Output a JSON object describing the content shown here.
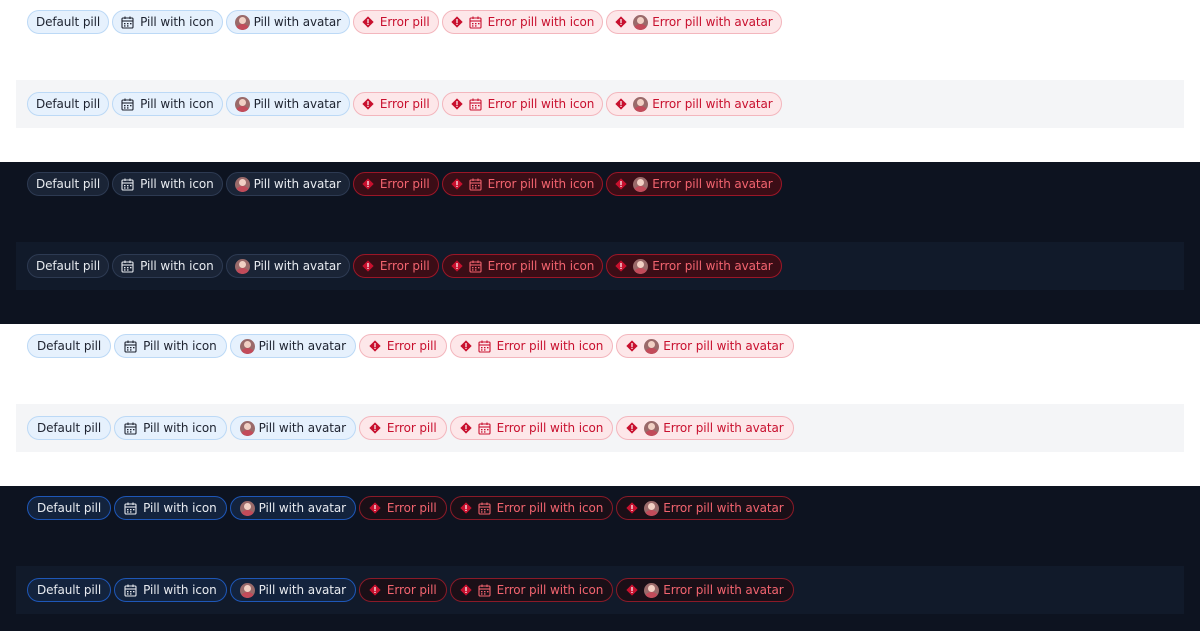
{
  "pills": {
    "default": "Default pill",
    "with_icon": "Pill with icon",
    "with_avatar": "Pill with avatar",
    "error": "Error pill",
    "error_with_icon": "Error pill with icon",
    "error_with_avatar": "Error pill with avatar"
  },
  "icons": {
    "calendar": "calendar-icon",
    "error": "error-diamond-icon",
    "avatar": "avatar"
  },
  "themes": [
    {
      "name": "light",
      "background": "#ffffff",
      "strip": "#f4f5f7"
    },
    {
      "name": "dark",
      "background": "#0d1320",
      "strip": "#111a2a"
    },
    {
      "name": "light-large",
      "background": "#ffffff",
      "strip": "#f4f5f7"
    },
    {
      "name": "dark-large",
      "background": "#0d1320",
      "strip": "#111a2a"
    }
  ],
  "colors": {
    "light_pill_bg": "#e6f1fd",
    "light_error_bg": "#fde7e9",
    "error_text": "#c8102e",
    "dark_error_text": "#f2646f",
    "dark_border_blue": "#1e57b8"
  }
}
